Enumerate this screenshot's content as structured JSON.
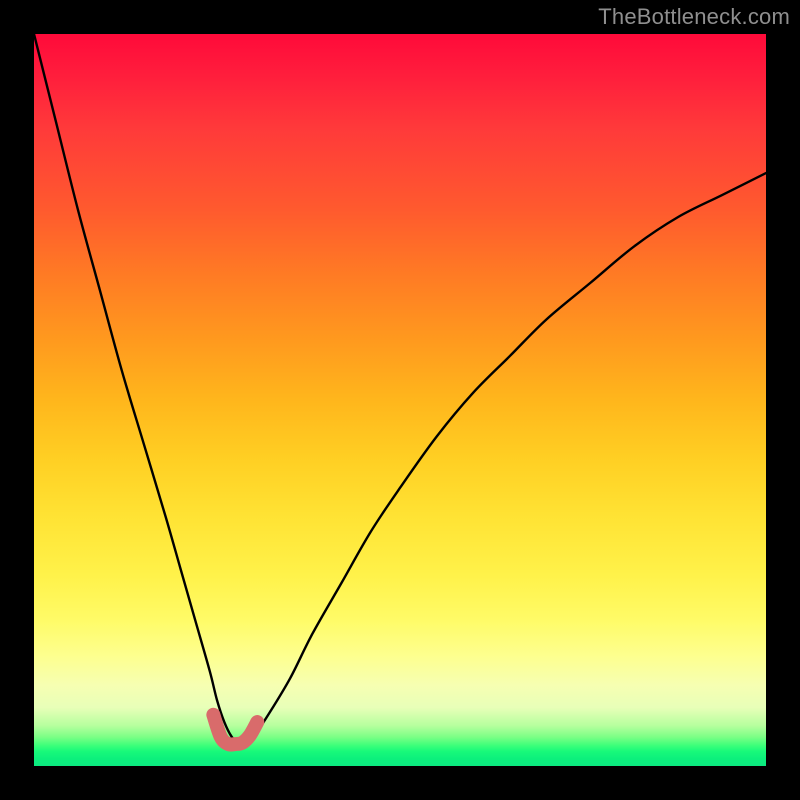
{
  "watermark": "TheBottleneck.com",
  "colors": {
    "page_bg": "#000000",
    "curve": "#000000",
    "dip_highlight": "#d96b6b",
    "gradient_top": "#ff0a3a",
    "gradient_bottom": "#0cea80"
  },
  "chart_data": {
    "type": "line",
    "title": "",
    "xlabel": "",
    "ylabel": "",
    "xlim": [
      0,
      100
    ],
    "ylim": [
      0,
      100
    ],
    "grid": false,
    "legend": false,
    "annotations": [],
    "series": [
      {
        "name": "bottleneck-curve",
        "x": [
          0,
          3,
          6,
          9,
          12,
          15,
          18,
          20,
          22,
          24,
          25,
          26,
          27,
          28,
          29,
          30,
          32,
          35,
          38,
          42,
          46,
          50,
          55,
          60,
          65,
          70,
          76,
          82,
          88,
          94,
          100
        ],
        "y": [
          100,
          88,
          76,
          65,
          54,
          44,
          34,
          27,
          20,
          13,
          9,
          6,
          4,
          3,
          3,
          4,
          7,
          12,
          18,
          25,
          32,
          38,
          45,
          51,
          56,
          61,
          66,
          71,
          75,
          78,
          81
        ]
      }
    ],
    "highlight": {
      "name": "sweet-spot",
      "x": [
        24.5,
        25.5,
        26.5,
        27.5,
        28.5,
        29.5,
        30.5
      ],
      "y": [
        7,
        4,
        3,
        3,
        3.2,
        4.2,
        6
      ]
    }
  }
}
